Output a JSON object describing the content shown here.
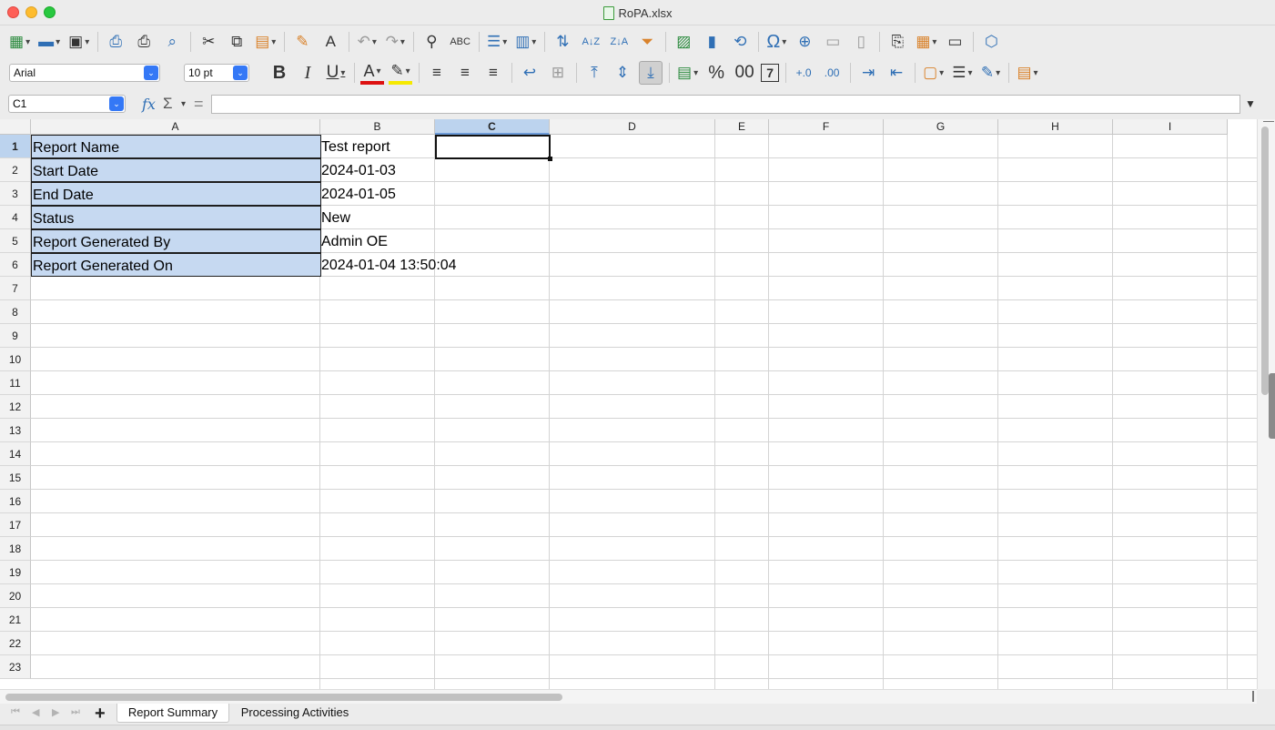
{
  "window": {
    "title": "RoPA.xlsx"
  },
  "format": {
    "font_name": "Arial",
    "font_size": "10 pt"
  },
  "formula_bar": {
    "cell_ref": "C1",
    "fx": "fx",
    "sigma": "Σ",
    "equals": "=",
    "value": ""
  },
  "columns": [
    "A",
    "B",
    "C",
    "D",
    "E",
    "F",
    "G",
    "H",
    "I"
  ],
  "rows": [
    "1",
    "2",
    "3",
    "4",
    "5",
    "6",
    "7",
    "8",
    "9",
    "10",
    "11",
    "12",
    "13",
    "14",
    "15",
    "16",
    "17",
    "18",
    "19",
    "20",
    "21",
    "22",
    "23"
  ],
  "cells": {
    "A1": "Report Name",
    "A2": "Start Date",
    "A3": "End Date",
    "A4": "Status",
    "A5": "Report Generated By",
    "A6": "Report Generated On",
    "B1": "Test report",
    "B2": "2024-01-03",
    "B3": "2024-01-05",
    "B4": "New",
    "B5": "Admin  OE",
    "B6": "2024-01-04 13:50:04"
  },
  "sheet_tabs": {
    "active": "Report Summary",
    "other": "Processing Activities"
  },
  "toolbar": {
    "bold": "B",
    "italic": "I",
    "underline": "U",
    "font_color": "A",
    "percent": "%",
    "decimal": "00",
    "number": "7",
    "add_decimal": "+.0",
    "del_decimal": ".00",
    "spell": "ABC",
    "sort_az": "A↓Z",
    "sort_za": "Z↓A",
    "special_char": "Ω",
    "add_sheet": "+"
  },
  "colors": {
    "selection": "#bcd3ee",
    "label_fill": "#c6d9f1",
    "accent": "#3478f6"
  }
}
